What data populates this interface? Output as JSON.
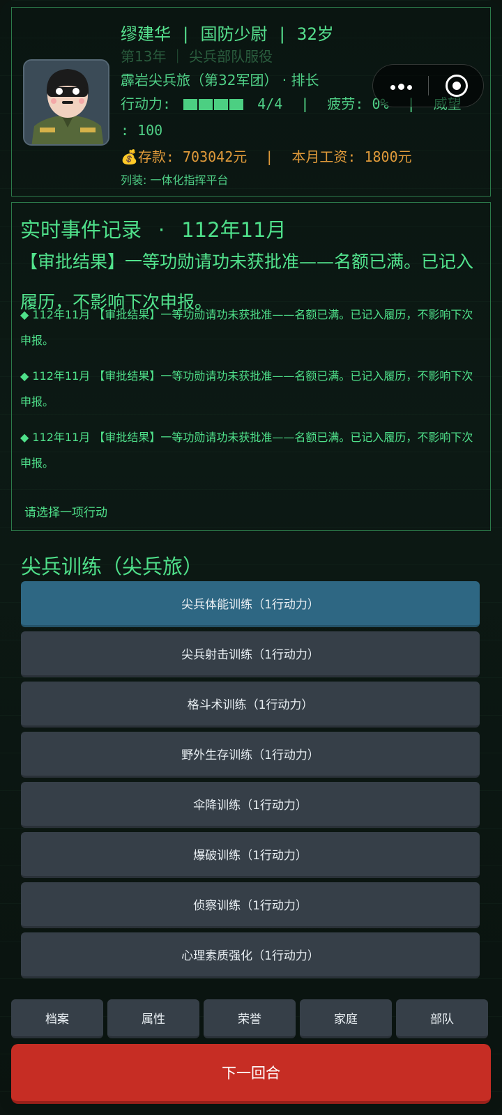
{
  "profile": {
    "name": "缪建华",
    "rank": "国防少尉",
    "age": "32岁",
    "service": "第13年 ｜ 尖兵部队服役",
    "unit": "霹岩尖兵旅（第32军团） · 排长",
    "ap_label": "行动力:",
    "ap_blocks_filled": 4,
    "ap_value": "4/4",
    "fatigue": "疲劳: 0%",
    "prestige_label": "威望",
    "prestige_value": ": 100",
    "savings": "💰存款: 703042元",
    "salary": "本月工资: 1800元",
    "equipment": "列装: 一体化指挥平台"
  },
  "capsule": {
    "more_icon": "more-dots-icon",
    "close_icon": "target-icon"
  },
  "events": {
    "title": "实时事件记录",
    "dot": "·",
    "date": "112年11月",
    "headline": "【审批结果】一等功勋请功未获批准——名额已满。已记入履历，不影响下次申报。",
    "items": [
      "◆ 112年11月 【审批结果】一等功勋请功未获批准——名额已满。已记入履历，不影响下次申报。",
      "◆ 112年11月 【审批结果】一等功勋请功未获批准——名额已满。已记入履历，不影响下次申报。",
      "◆ 112年11月 【审批结果】一等功勋请功未获批准——名额已满。已记入履历，不影响下次申报。"
    ],
    "prompt": "请选择一项行动"
  },
  "training": {
    "title": "尖兵训练（尖兵旅）",
    "options": [
      "尖兵体能训练（1行动力）",
      "尖兵射击训练（1行动力）",
      "格斗术训练（1行动力）",
      "野外生存训练（1行动力）",
      "伞降训练（1行动力）",
      "爆破训练（1行动力）",
      "侦察训练（1行动力）",
      "心理素质强化（1行动力）"
    ]
  },
  "tabs": [
    "档案",
    "属性",
    "荣誉",
    "家庭",
    "部队"
  ],
  "next_button": "下一回合",
  "colors": {
    "accent_green": "#4fe08a",
    "money": "#e09a3a",
    "active_button": "#2e6783",
    "button": "#363f48",
    "next": "#c62d24"
  }
}
